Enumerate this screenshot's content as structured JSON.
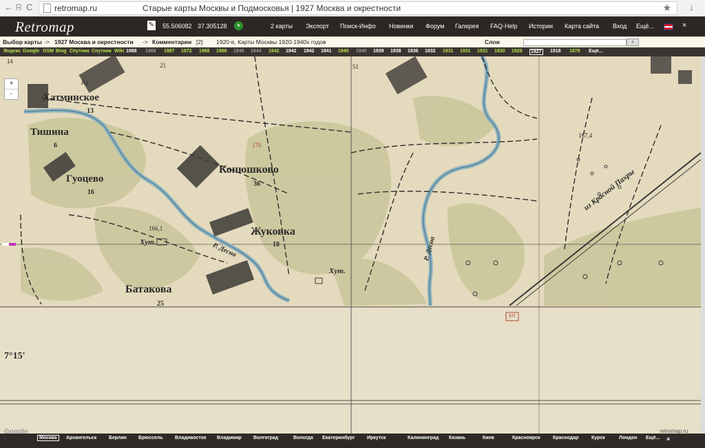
{
  "browser": {
    "back_icon": "←",
    "forward_icon": "Я",
    "refresh_icon": "C",
    "url_host": "retromap.ru",
    "page_title": "Старые карты Москвы и Подмосковья | 1927 Москва и окрестности",
    "bookmark_icon": "★",
    "download_icon": "↓"
  },
  "header": {
    "logo": "Retromap",
    "latitude": "55.506082",
    "longitude": "37.305128",
    "menu": [
      "2 карты",
      "Экспорт",
      "Поиск-Инфо",
      "Новинки",
      "Форум",
      "Галерея",
      "FAQ-Help",
      "Истории",
      "Карта сайта",
      "Вход",
      "Ещё..."
    ],
    "close": "×"
  },
  "breadcrumb": {
    "select_map": "Выбор карты",
    "arrow1": "->",
    "map_name": "1927 Москва и окрестности",
    "arrow2": "->",
    "comments": "Комментарии",
    "comments_count": "[2]",
    "description": "1920-е, Карты Москвы 1920-1940х годов",
    "layers_label": "Слои"
  },
  "years_bar": {
    "items": [
      {
        "t": "Яндекс",
        "c": "y-link"
      },
      {
        "t": "Google",
        "c": "y-link"
      },
      {
        "t": "OSM",
        "c": "y-link"
      },
      {
        "t": "Bing",
        "c": "y-link"
      },
      {
        "t": "Спутник",
        "c": "y-link"
      },
      {
        "t": "Спутник",
        "c": "y-link"
      },
      {
        "t": "Wiki",
        "c": "y-link"
      },
      {
        "t": "1988",
        "c": "y-main"
      },
      {
        "t": "1988",
        "c": "y-gray"
      },
      {
        "t": "1987",
        "c": "y-link"
      },
      {
        "t": "1972",
        "c": "y-link"
      },
      {
        "t": "1968",
        "c": "y-link"
      },
      {
        "t": "1966",
        "c": "y-link"
      },
      {
        "t": "1946",
        "c": "y-gray"
      },
      {
        "t": "1944",
        "c": "y-gray"
      },
      {
        "t": "1942",
        "c": "y-link"
      },
      {
        "t": "1942",
        "c": "y-main"
      },
      {
        "t": "1942",
        "c": "y-main"
      },
      {
        "t": "1941",
        "c": "y-main"
      },
      {
        "t": "1940",
        "c": "y-link"
      },
      {
        "t": "1940",
        "c": "y-gray"
      },
      {
        "t": "1939",
        "c": "y-main"
      },
      {
        "t": "1938",
        "c": "y-main"
      },
      {
        "t": "1936",
        "c": "y-main"
      },
      {
        "t": "1932",
        "c": "y-main"
      },
      {
        "t": "1931",
        "c": "y-link"
      },
      {
        "t": "1931",
        "c": "y-link"
      },
      {
        "t": "1931",
        "c": "y-link"
      },
      {
        "t": "1930",
        "c": "y-link"
      },
      {
        "t": "1929",
        "c": "y-link"
      },
      {
        "t": "1927",
        "c": "y-sel"
      },
      {
        "t": "1918",
        "c": "y-main"
      },
      {
        "t": "1878",
        "c": "y-link"
      },
      {
        "t": "Ещё...",
        "c": "y-main"
      }
    ]
  },
  "map": {
    "zoom": "14",
    "zoom_in": "+",
    "zoom_out": "-",
    "labels": {
      "khatminskoe": "Хатминское",
      "khatminskoe_n": "13",
      "tishina": "Тишина",
      "tishina_n": "6",
      "guotsevo": "Гуоцево",
      "guotsevo_n": "16",
      "konyushkovo": "Конюшково",
      "konyushkovo_n": "36",
      "zhukovka": "Жуковка",
      "zhukovka_n": "18",
      "batakova": "Батакова",
      "batakova_n": "25",
      "khut1": "Хут.",
      "khut2": "Хут.",
      "river_desna1": "Р. Десна",
      "river_desna2": "Р. Десна",
      "road": "из Красной Пахры",
      "elev1": "166,1",
      "elev2": "167,4",
      "elev3": "170",
      "num21": "21",
      "num51": "51",
      "kl": "Кл.",
      "kp": "КП",
      "corner": "7°15'"
    }
  },
  "bottom": {
    "google": "Google",
    "credit": "retromap.ru",
    "cities": [
      "Москва",
      "Архангельск",
      "Берлин",
      "Брюссель",
      "Владивосток",
      "Владимир",
      "Волгоград",
      "Вологда",
      "Екатеринбург",
      "Иркутск",
      "Калининград",
      "Казань",
      "Киев",
      "Красноярск",
      "Краснодар",
      "Курск",
      "Лондон",
      "Ещё..."
    ],
    "close": "×"
  }
}
